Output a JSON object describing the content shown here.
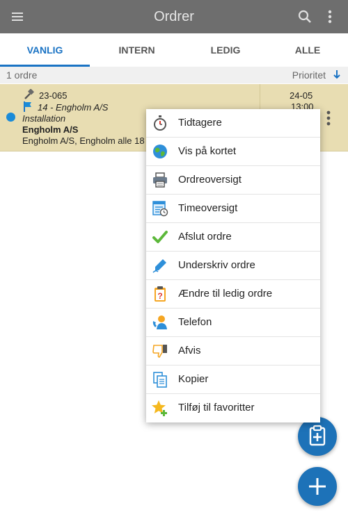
{
  "appbar": {
    "title": "Ordrer",
    "menu_icon": "hamburger-menu-icon",
    "search_icon": "search-icon",
    "more_icon": "more-vert-icon"
  },
  "tabs": [
    {
      "label": "VANLIG",
      "active": true
    },
    {
      "label": "INTERN",
      "active": false
    },
    {
      "label": "LEDIG",
      "active": false
    },
    {
      "label": "ALLE",
      "active": false
    }
  ],
  "colors": {
    "accent": "#1a73c4",
    "appbar": "#6e6e6e",
    "row_highlight": "#e8ddb2",
    "fab": "#1d72b8"
  },
  "list_header": {
    "count": "1 ordre",
    "sort_label": "Prioritet",
    "sort_icon": "arrow-down-icon"
  },
  "order": {
    "number": "23-065",
    "customer_line": "14 - Engholm A/S",
    "type": "Installation",
    "name": "Engholm A/S",
    "address": "Engholm A/S, Engholm alle 18",
    "date": "24-05",
    "time": "13:00",
    "status_color": "#1a8bd8"
  },
  "context_menu": {
    "items": [
      {
        "label": "Tidtagere",
        "icon": "stopwatch-icon"
      },
      {
        "label": "Vis på kortet",
        "icon": "globe-icon"
      },
      {
        "label": "Ordreoversigt",
        "icon": "printer-icon"
      },
      {
        "label": "Timeoversigt",
        "icon": "timesheet-icon"
      },
      {
        "label": "Afslut ordre",
        "icon": "checkmark-icon"
      },
      {
        "label": "Underskriv ordre",
        "icon": "pen-icon"
      },
      {
        "label": "Ændre til ledig ordre",
        "icon": "clipboard-question-icon"
      },
      {
        "label": "Telefon",
        "icon": "phone-contact-icon"
      },
      {
        "label": "Afvis",
        "icon": "thumbs-down-icon"
      },
      {
        "label": "Kopier",
        "icon": "copy-icon"
      },
      {
        "label": "Tilføj til favoritter",
        "icon": "star-add-icon"
      }
    ]
  },
  "fabs": {
    "clipboard": "clipboard-add-icon",
    "add": "plus-icon"
  }
}
